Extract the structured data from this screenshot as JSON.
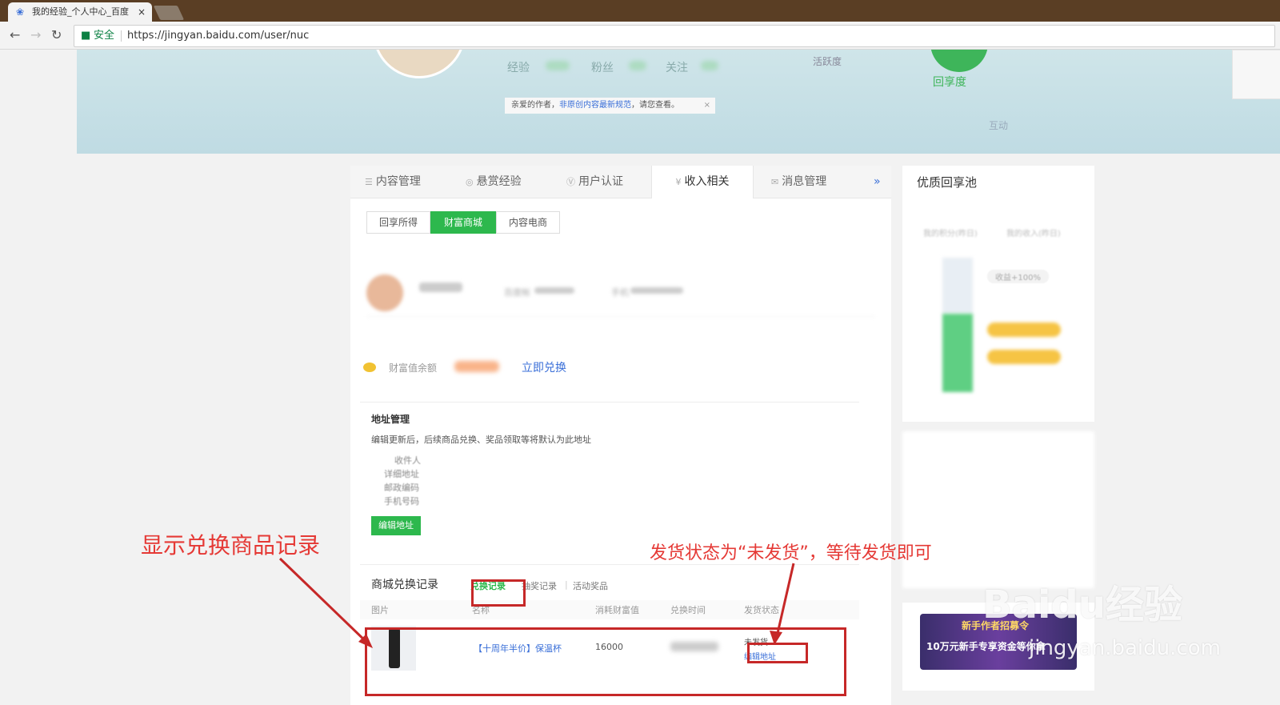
{
  "browser": {
    "tab_title": "我的经验_个人中心_百度",
    "tab_close": "×",
    "secure_label": "安全",
    "url": "https://jingyan.baidu.com/user/nuc"
  },
  "banner": {
    "stats": [
      "经验",
      "粉丝",
      "关注"
    ],
    "huoyue": "活跃度",
    "huixiang": "回享度",
    "hudong": "互动",
    "notice_prefix": "亲爱的作者，",
    "notice_link": "非原创内容最新规范",
    "notice_suffix": "，请您查看。",
    "notice_close": "×"
  },
  "main": {
    "tabs": [
      {
        "icon": "☰",
        "label": "内容管理"
      },
      {
        "icon": "◎",
        "label": "悬赏经验"
      },
      {
        "icon": "Ⓥ",
        "label": "用户认证"
      },
      {
        "icon": "¥",
        "label": "收入相关"
      },
      {
        "icon": "✉",
        "label": "消息管理"
      }
    ],
    "more": "»",
    "subtabs": [
      "回享所得",
      "财富商城",
      "内容电商"
    ],
    "profile": {
      "baidu_account": "百度帐",
      "phone": "手机"
    },
    "wealth_label": "财富值余额",
    "redeem": "立即兑换",
    "address": {
      "title": "地址管理",
      "desc": "编辑更新后，后续商品兑换、奖品领取等将默认为此地址",
      "fields": [
        "收件人",
        "详细地址",
        "邮政编码",
        "手机号码"
      ],
      "edit_button": "编辑地址"
    },
    "shop": {
      "title": "商城兑换记录",
      "tabs": [
        "兑换记录",
        "抽奖记录",
        "活动奖品"
      ],
      "separator": "|",
      "headers": [
        "图片",
        "名称",
        "消耗财富值",
        "兑换时间",
        "发货状态"
      ],
      "row": {
        "name": "【十周年半价】保温杯",
        "cost": "16000",
        "status": "未发货",
        "edit": "编辑地址"
      }
    }
  },
  "side": {
    "title": "优质回享池",
    "labels": [
      "我的积分(昨日)",
      "我的收入(昨日)"
    ],
    "badge": "收益+100%",
    "ad_line1": "新手作者招募令",
    "ad_line2": "10万元新手专享资金等你拿"
  },
  "annotations": {
    "left": "显示兑换商品记录",
    "right": "发货状态为“未发货”，等待发货即可"
  },
  "watermark": {
    "brand": "Baidu经验",
    "domain": "jingyan.baidu.com"
  }
}
